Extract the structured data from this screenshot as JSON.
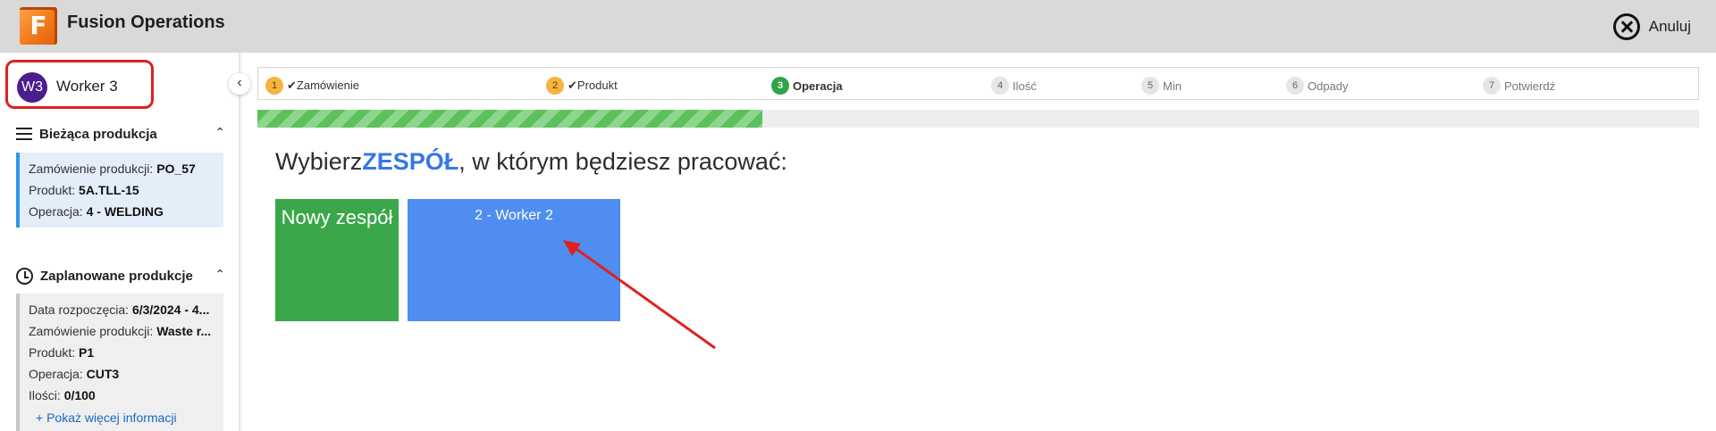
{
  "header": {
    "logo_letter": "F",
    "app_title": "Fusion Operations",
    "cancel_label": "Anuluj"
  },
  "sidebar": {
    "user": {
      "initials": "W3",
      "name": "Worker 3"
    },
    "current": {
      "title": "Bieżąca produkcja",
      "rows": [
        {
          "label": "Zamówienie produkcji:",
          "value": "PO_57"
        },
        {
          "label": "Produkt:",
          "value": "5A.TLL-15"
        },
        {
          "label": "Operacja:",
          "value": "4 - WELDING"
        }
      ]
    },
    "planned": {
      "title": "Zaplanowane produkcje",
      "rows": [
        {
          "label": "Data rozpoczęcia:",
          "value": "6/3/2024 - 4..."
        },
        {
          "label": "Zamówienie produkcji:",
          "value": "Waste r..."
        },
        {
          "label": "Produkt:",
          "value": "P1"
        },
        {
          "label": "Operacja:",
          "value": "CUT3"
        },
        {
          "label": "Ilości:",
          "value": "0/100"
        }
      ],
      "more_link": "+  Pokaż więcej informacji"
    }
  },
  "stepper": {
    "steps": [
      {
        "num": "1",
        "label": "✔Zamówienie",
        "state": "done"
      },
      {
        "num": "2",
        "label": "✔Produkt",
        "state": "done"
      },
      {
        "num": "3",
        "label": "Operacja",
        "state": "active"
      },
      {
        "num": "4",
        "label": "Ilość",
        "state": "todo"
      },
      {
        "num": "5",
        "label": "Min",
        "state": "todo"
      },
      {
        "num": "6",
        "label": "Odpady",
        "state": "todo"
      },
      {
        "num": "7",
        "label": "Potwierdź",
        "state": "todo"
      }
    ],
    "progress_fraction": 0.35
  },
  "main": {
    "heading_prefix": "Wybierz",
    "heading_highlight": "ZESPÓŁ",
    "heading_suffix": ", w którym będziesz pracować:",
    "tiles": {
      "new_team": "Nowy zespół",
      "team": "2 - Worker 2"
    }
  },
  "colors": {
    "accent": "#3577e6",
    "tile_new": "#3aa84a",
    "tile_team": "#4f8ef0",
    "highlight_border": "#e02020",
    "arrow": "#e02020"
  }
}
